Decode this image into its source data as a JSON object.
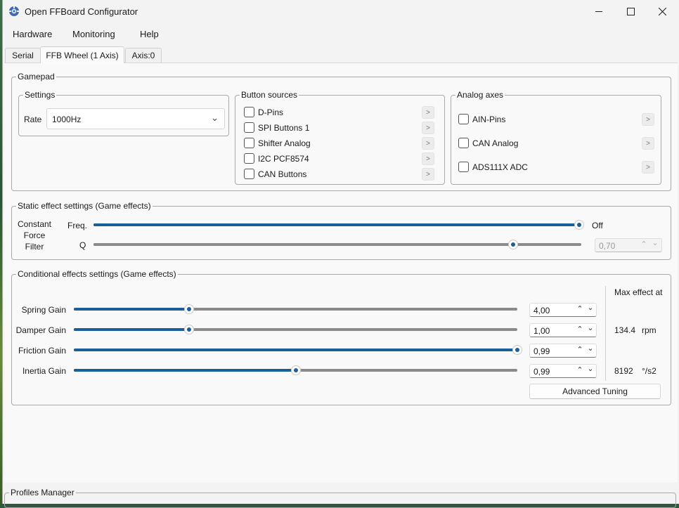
{
  "window": {
    "title": "Open FFBoard Configurator"
  },
  "menu": {
    "hardware": "Hardware",
    "monitoring": "Monitoring",
    "help": "Help"
  },
  "tabs": {
    "serial": "Serial",
    "ffb_wheel": "FFB Wheel (1 Axis)",
    "axis": "Axis:0"
  },
  "gamepad": {
    "title": "Gamepad",
    "settings": {
      "title": "Settings",
      "rate_label": "Rate",
      "rate_value": "1000Hz"
    },
    "button_sources": {
      "title": "Button sources",
      "items": [
        {
          "label": "D-Pins",
          "checked": false
        },
        {
          "label": "SPI Buttons 1",
          "checked": false
        },
        {
          "label": "Shifter Analog",
          "checked": false
        },
        {
          "label": "I2C PCF8574",
          "checked": false
        },
        {
          "label": "CAN Buttons",
          "checked": false
        }
      ]
    },
    "analog_axes": {
      "title": "Analog axes",
      "items": [
        {
          "label": "AIN-Pins",
          "checked": false
        },
        {
          "label": "CAN Analog",
          "checked": false
        },
        {
          "label": "ADS111X ADC",
          "checked": false
        }
      ]
    },
    "arrow_glyph": ">"
  },
  "static_effects": {
    "title": "Static effect settings (Game effects)",
    "side_label": [
      "Constant",
      "Force",
      "Filter"
    ],
    "freq_label": "Freq.",
    "freq_value_text": "Off",
    "freq_level": 1.0,
    "q_label": "Q",
    "q_level": 0.86,
    "q_value": "0,70"
  },
  "conditional_effects": {
    "title": "Conditional effects settings (Game effects)",
    "max_effect_label": "Max effect at",
    "rows": [
      {
        "label": "Spring Gain",
        "value": "4,00",
        "level": 0.26
      },
      {
        "label": "Damper Gain",
        "value": "1,00",
        "level": 0.26
      },
      {
        "label": "Friction Gain",
        "value": "0,99",
        "level": 1.0
      },
      {
        "label": "Inertia Gain",
        "value": "0,99",
        "level": 0.5
      }
    ],
    "damper_max": {
      "value": "134.4",
      "unit": "rpm"
    },
    "inertia_max": {
      "value": "8192",
      "unit": "°/s2"
    },
    "advanced_tuning": "Advanced Tuning"
  },
  "profiles": {
    "title": "Profiles Manager"
  },
  "icons": {
    "up": "⌃",
    "down": "⌄",
    "chevron": "⌄"
  },
  "colors": {
    "accent": "#1b5e9c",
    "track": "#8a8a8a"
  }
}
